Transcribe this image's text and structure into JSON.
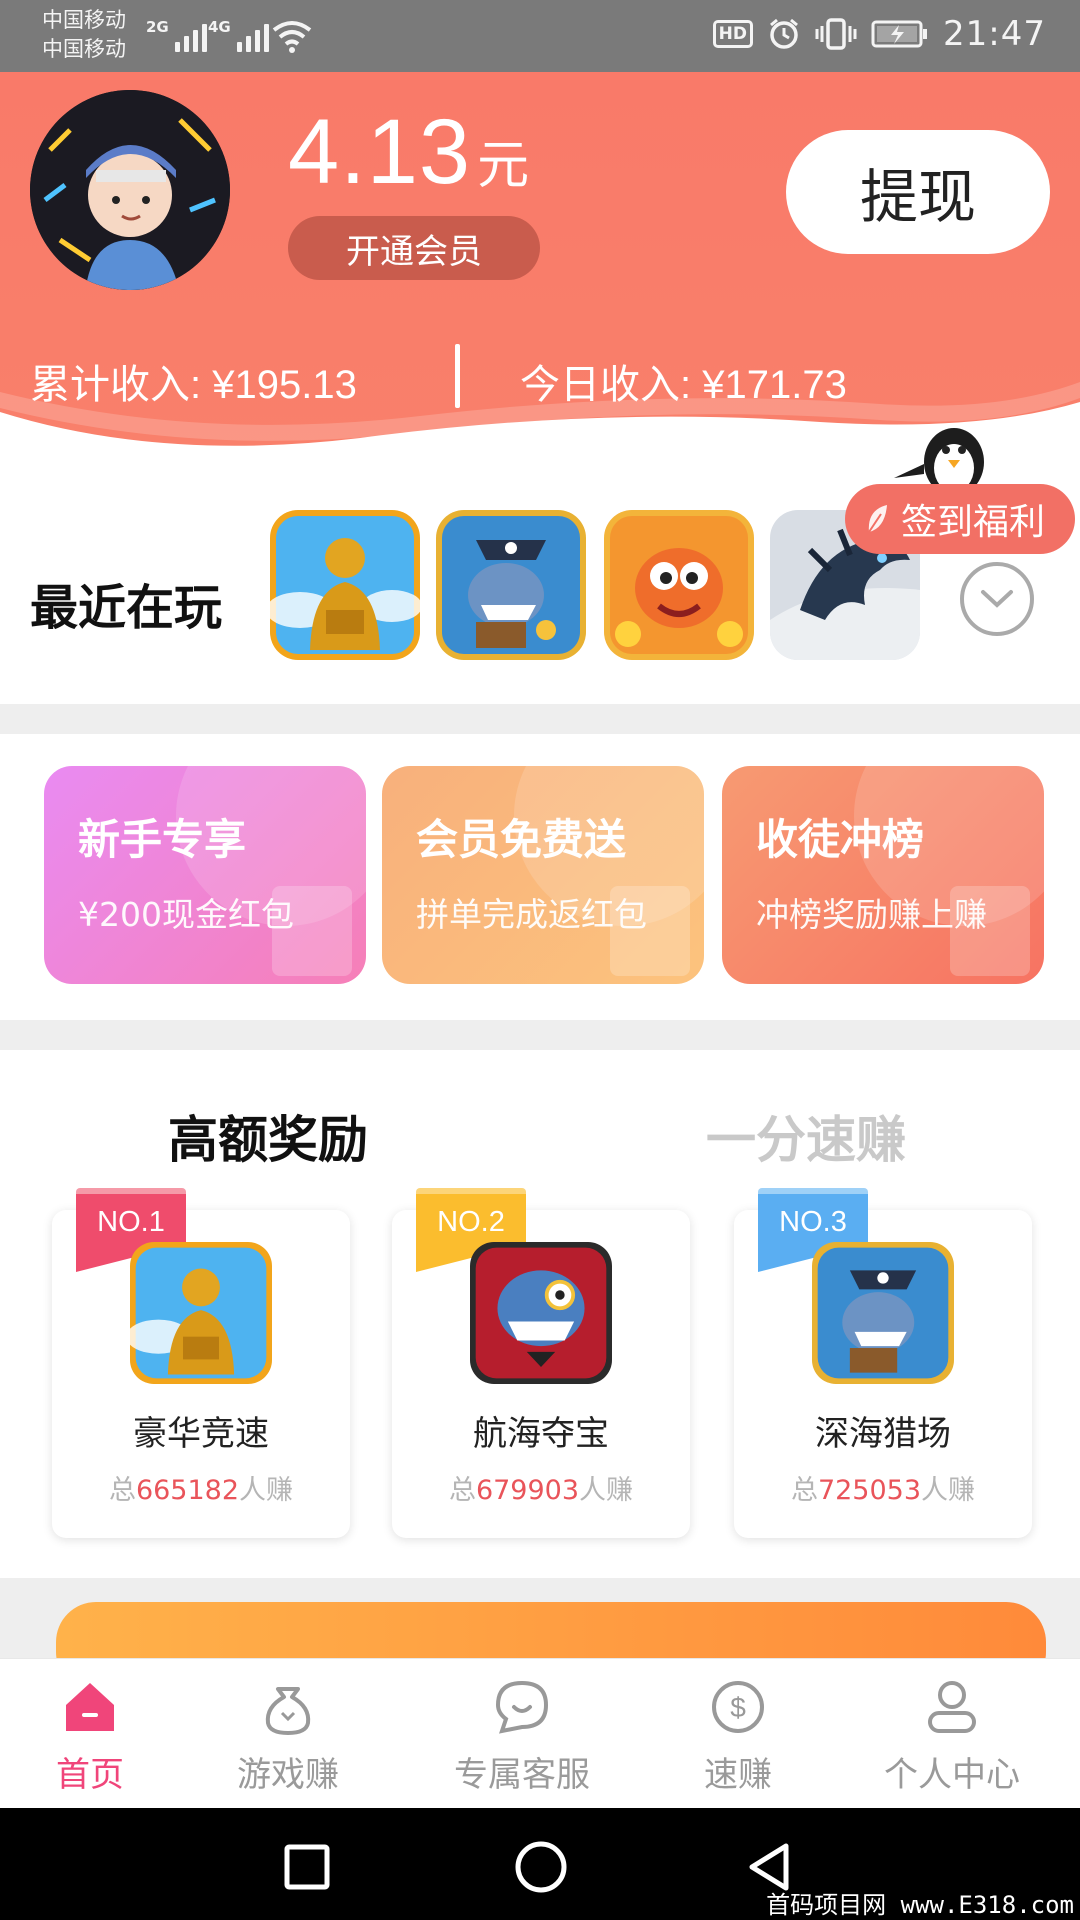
{
  "status_bar": {
    "carrier_1": "中国移动",
    "carrier_2": "中国移动",
    "net_1": "2G",
    "net_2": "4G",
    "hd": "HD",
    "time": "21:47"
  },
  "header": {
    "balance_value": "4.13",
    "balance_unit": "元",
    "vip_button": "开通会员",
    "withdraw_button": "提现",
    "total_income_label": "累计收入: ¥195.13",
    "today_income_label": "今日收入: ¥171.73"
  },
  "recent": {
    "title": "最近在玩",
    "sign_in_label": "签到福利",
    "games": [
      {
        "icon": "golden-statue-game-icon"
      },
      {
        "icon": "pirate-shark-game-icon"
      },
      {
        "icon": "fish-coins-game-icon"
      },
      {
        "icon": "dragon-game-icon"
      }
    ]
  },
  "promos": [
    {
      "title": "新手专享",
      "subtitle": "¥200现金红包",
      "color_from": "#e98bf2",
      "color_to": "#f67fb7"
    },
    {
      "title": "会员免费送",
      "subtitle": "拼单完成返红包",
      "color_from": "#f8b07c",
      "color_to": "#fcc37d"
    },
    {
      "title": "收徒冲榜",
      "subtitle": "冲榜奖励赚上赚",
      "color_from": "#f79a72",
      "color_to": "#f77362"
    }
  ],
  "rewards": {
    "tab_active": "高额奖励",
    "tab_inactive": "一分速赚",
    "items": [
      {
        "rank": "NO.1",
        "name": "豪华竞速",
        "prefix": "总",
        "count": "665182",
        "suffix": "人赚",
        "flag_color": "#ef4c6c"
      },
      {
        "rank": "NO.2",
        "name": "航海夺宝",
        "prefix": "总",
        "count": "679903",
        "suffix": "人赚",
        "flag_color": "#fbbd2e"
      },
      {
        "rank": "NO.3",
        "name": "深海猎场",
        "prefix": "总",
        "count": "725053",
        "suffix": "人赚",
        "flag_color": "#5aaef2"
      }
    ]
  },
  "bottom_nav": [
    {
      "label": "首页",
      "icon": "home-icon",
      "active": true
    },
    {
      "label": "游戏赚",
      "icon": "money-bag-icon",
      "active": false
    },
    {
      "label": "专属客服",
      "icon": "chat-bubble-icon",
      "active": false
    },
    {
      "label": "速赚",
      "icon": "dollar-coin-icon",
      "active": false
    },
    {
      "label": "个人中心",
      "icon": "person-icon",
      "active": false
    }
  ],
  "watermark": "首码项目网 www.E318.com",
  "colors": {
    "header_bg": "#f97a69",
    "accent_pink": "#f0457a",
    "count_red": "#e9545a"
  }
}
